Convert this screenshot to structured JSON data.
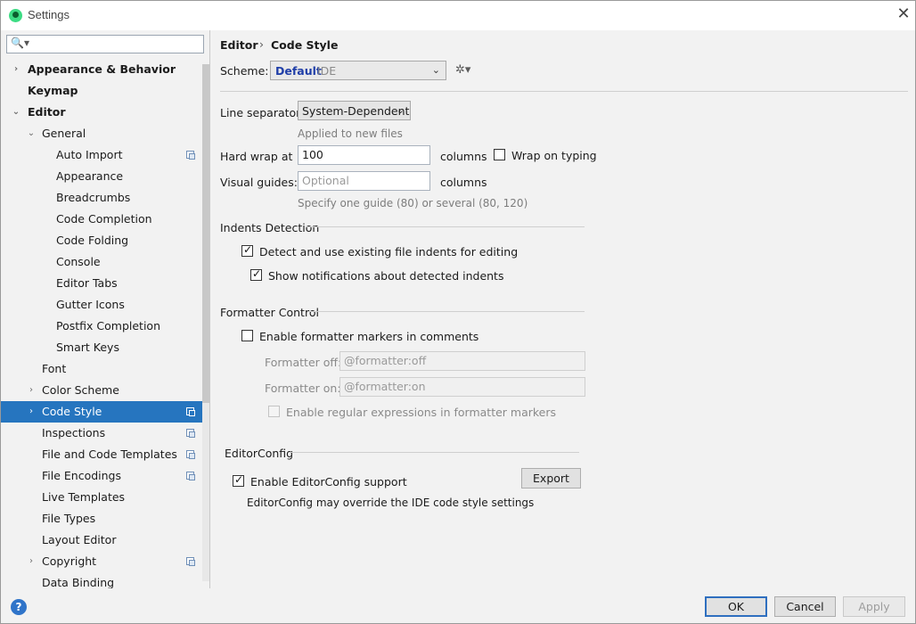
{
  "window": {
    "title": "Settings",
    "close_glyph": "✕"
  },
  "sidebar": {
    "search": {
      "value": "",
      "glyph": "🔍▾"
    },
    "items": [
      {
        "label": "Appearance & Behavior",
        "bold": true,
        "arrow": "›",
        "indent": 0
      },
      {
        "label": "Keymap",
        "bold": true,
        "arrow": "",
        "indent": 0
      },
      {
        "label": "Editor",
        "bold": true,
        "arrow": "⌄",
        "indent": 0
      },
      {
        "label": "General",
        "bold": false,
        "arrow": "⌄",
        "indent": 1
      },
      {
        "label": "Auto Import",
        "bold": false,
        "arrow": "",
        "indent": 2,
        "copy_icon": true
      },
      {
        "label": "Appearance",
        "bold": false,
        "arrow": "",
        "indent": 2
      },
      {
        "label": "Breadcrumbs",
        "bold": false,
        "arrow": "",
        "indent": 2
      },
      {
        "label": "Code Completion",
        "bold": false,
        "arrow": "",
        "indent": 2
      },
      {
        "label": "Code Folding",
        "bold": false,
        "arrow": "",
        "indent": 2
      },
      {
        "label": "Console",
        "bold": false,
        "arrow": "",
        "indent": 2
      },
      {
        "label": "Editor Tabs",
        "bold": false,
        "arrow": "",
        "indent": 2
      },
      {
        "label": "Gutter Icons",
        "bold": false,
        "arrow": "",
        "indent": 2
      },
      {
        "label": "Postfix Completion",
        "bold": false,
        "arrow": "",
        "indent": 2
      },
      {
        "label": "Smart Keys",
        "bold": false,
        "arrow": "",
        "indent": 2
      },
      {
        "label": "Font",
        "bold": false,
        "arrow": "",
        "indent": 1
      },
      {
        "label": "Color Scheme",
        "bold": false,
        "arrow": "›",
        "indent": 1
      },
      {
        "label": "Code Style",
        "bold": false,
        "arrow": "›",
        "indent": 1,
        "copy_icon": true,
        "selected": true
      },
      {
        "label": "Inspections",
        "bold": false,
        "arrow": "",
        "indent": 1,
        "copy_icon": true
      },
      {
        "label": "File and Code Templates",
        "bold": false,
        "arrow": "",
        "indent": 1,
        "copy_icon": true
      },
      {
        "label": "File Encodings",
        "bold": false,
        "arrow": "",
        "indent": 1,
        "copy_icon": true
      },
      {
        "label": "Live Templates",
        "bold": false,
        "arrow": "",
        "indent": 1
      },
      {
        "label": "File Types",
        "bold": false,
        "arrow": "",
        "indent": 1
      },
      {
        "label": "Layout Editor",
        "bold": false,
        "arrow": "",
        "indent": 1
      },
      {
        "label": "Copyright",
        "bold": false,
        "arrow": "›",
        "indent": 1,
        "copy_icon": true
      },
      {
        "label": "Data Binding",
        "bold": false,
        "arrow": "",
        "indent": 1
      }
    ]
  },
  "breadcrumb": {
    "parent": "Editor",
    "separator": "›",
    "current": "Code Style"
  },
  "scheme": {
    "label": "Scheme:",
    "name": "Default",
    "scope": "IDE",
    "chevron": "⌄",
    "gear_glyph": "✲▾"
  },
  "line_separator": {
    "label": "Line separator:",
    "value": "System-Dependent",
    "chevron": "⌄",
    "hint": "Applied to new files"
  },
  "hard_wrap": {
    "label": "Hard wrap at",
    "value": "100",
    "unit": "columns"
  },
  "wrap_on_typing": {
    "label": "Wrap on typing",
    "checked": false
  },
  "visual_guides": {
    "label": "Visual guides:",
    "placeholder": "Optional",
    "unit": "columns",
    "hint": "Specify one guide (80) or several (80, 120)"
  },
  "indents_detection": {
    "title": "Indents Detection",
    "detect": {
      "label": "Detect and use existing file indents for editing",
      "checked": true
    },
    "notify": {
      "label": "Show notifications about detected indents",
      "checked": true
    }
  },
  "formatter_control": {
    "title": "Formatter Control",
    "enable_markers": {
      "label": "Enable formatter markers in comments",
      "checked": false
    },
    "off": {
      "label": "Formatter off:",
      "value": "@formatter:off"
    },
    "on": {
      "label": "Formatter on:",
      "value": "@formatter:on"
    },
    "regex": {
      "label": "Enable regular expressions in formatter markers",
      "checked": false
    }
  },
  "editorconfig": {
    "title": "EditorConfig",
    "enable": {
      "label": "Enable EditorConfig support",
      "checked": true
    },
    "export_label": "Export",
    "note": "EditorConfig may override the IDE code style settings"
  },
  "buttons": {
    "ok": "OK",
    "cancel": "Cancel",
    "apply": "Apply",
    "help": "?"
  },
  "colors": {
    "selection": "#2675bf",
    "scheme_name": "#1f3ea8",
    "primary_border": "#2f6fbf"
  }
}
